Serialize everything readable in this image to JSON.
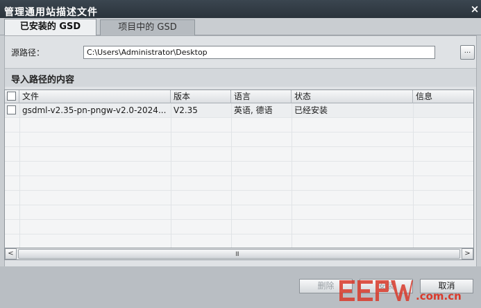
{
  "window": {
    "title": "管理通用站描述文件",
    "close_glyph": "×"
  },
  "tabs": [
    {
      "label": "已安装的 GSD",
      "active": true
    },
    {
      "label": "项目中的 GSD",
      "active": false
    }
  ],
  "source": {
    "label": "源路径：",
    "value": "C:\\Users\\Administrator\\Desktop",
    "browse_label": "..."
  },
  "section": {
    "title": "导入路径的内容"
  },
  "table": {
    "columns": [
      "文件",
      "版本",
      "语言",
      "状态",
      "信息"
    ],
    "rows": [
      {
        "file": "gsdml-v2.35-pn-pngw-v2.0-2024...",
        "version": "V2.35",
        "language": "英语, 德语",
        "status": "已经安装",
        "info": ""
      }
    ]
  },
  "scrollbar": {
    "left_glyph": "<",
    "right_glyph": ">",
    "grip_glyph": "III"
  },
  "buttons": {
    "delete": "删除",
    "install": "安装",
    "cancel": "取消"
  },
  "watermark": {
    "domain": ".com.cn"
  },
  "colors": {
    "title_bar": "#2a333b",
    "dialog_bg": "#c9cdd1",
    "watermark_red": "#d93a2b"
  }
}
